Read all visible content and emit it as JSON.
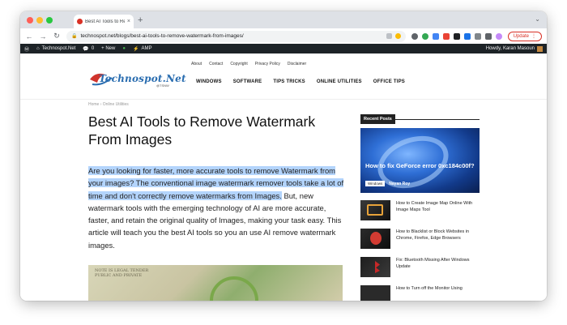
{
  "browser": {
    "tab_title": "Best AI Tools to Remove Wate",
    "tab_close": "×",
    "new_tab": "+",
    "url": "technospot.net/blogs/best-ai-tools-to-remove-watermark-from-images/",
    "update_label": "Update",
    "menu_glyph": "⋮",
    "back": "←",
    "forward": "→",
    "reload": "↻"
  },
  "adminbar": {
    "site": "Technospot.Net",
    "comments": "0",
    "new": "+ New",
    "amp": "AMP",
    "howdy": "Howdy, Karan Masoun"
  },
  "site": {
    "logo_text": "Technospot.Net",
    "logo_sub": "@TSNW",
    "top_links": [
      "About",
      "Contact",
      "Copyright",
      "Privacy Policy",
      "Disclaimer"
    ],
    "nav": [
      "WINDOWS",
      "SOFTWARE",
      "TIPS TRICKS",
      "ONLINE UTILITIES",
      "OFFICE TIPS"
    ]
  },
  "article": {
    "breadcrumb": "Home  ›  Online Utilities",
    "title": "Best AI Tools to Remove Watermark From Images",
    "highlighted": "Are you looking for faster, more accurate tools to remove Watermark from your images? The conventional image watermark remover tools take a lot of time and don't correctly remove watermarks from Images.",
    "rest": " But, new watermark tools with the emerging technology of AI are more accurate, faster, and retain the original quality of Images, making your task easy. This article will teach you the best AI tools so you an use AI remove watermark images.",
    "image_text": "NOTE IS LEGAL TENDER\nPUBLIC AND PRIVATE"
  },
  "sidebar": {
    "heading": "Recent Posts",
    "featured": {
      "title": "How to fix GeForce error 0xc184c00f?",
      "category": "Windows",
      "author": "Nayan Roy"
    },
    "posts": [
      {
        "title": "How to Create Image Map Online With Image Maps Tool"
      },
      {
        "title": "How to Blacklist or Block Websites in Chrome, Firefox, Edge Browsers"
      },
      {
        "title": "Fix: Bluetooth Missing After Windows Update"
      },
      {
        "title": "How to Turn off the Monitor Using"
      }
    ]
  },
  "colors": {
    "highlight": "#b3d4fc",
    "update": "#d93025",
    "adminbar": "#1d2327"
  }
}
